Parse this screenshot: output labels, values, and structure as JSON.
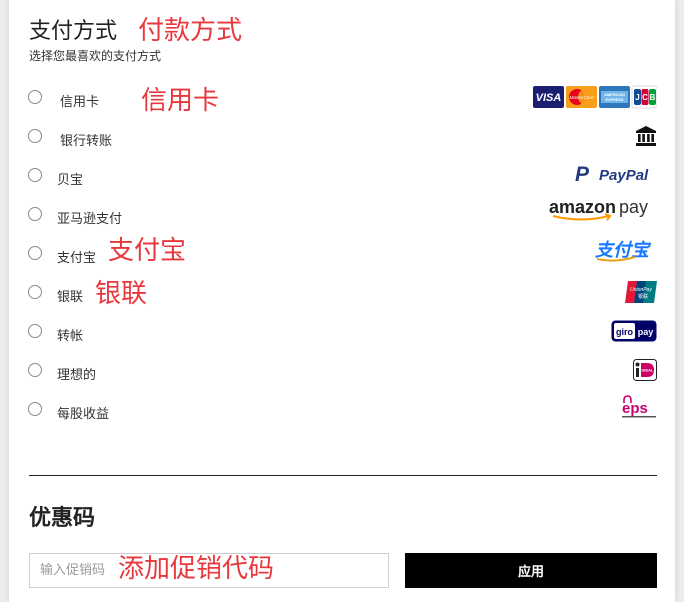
{
  "payment": {
    "title": "支付方式",
    "title_annotation": "付款方式",
    "subtitle": "选择您最喜欢的支付方式",
    "methods": [
      {
        "label": "信用卡",
        "annotation": "信用卡",
        "logo": "visa-mastercard-amex-jcb-logos",
        "logo_text": [
          "VISA",
          "MasterCard",
          "AMERICAN EXPRESS",
          "JCB"
        ]
      },
      {
        "label": "银行转账",
        "logo": "bank-icon"
      },
      {
        "label": "贝宝",
        "logo": "paypal-logo",
        "logo_text": [
          "PayPal"
        ]
      },
      {
        "label": "亚马逊支付",
        "logo": "amazon-pay-logo",
        "logo_text": [
          "amazon",
          "pay"
        ]
      },
      {
        "label": "支付宝",
        "annotation": "支付宝",
        "logo": "alipay-logo",
        "logo_text": [
          "支付宝"
        ]
      },
      {
        "label": "银联",
        "annotation": "银联",
        "logo": "unionpay-logo",
        "logo_text": [
          "UnionPay",
          "银联"
        ]
      },
      {
        "label": "转帐",
        "logo": "giropay-logo",
        "logo_text": [
          "giro",
          "pay"
        ]
      },
      {
        "label": "理想的",
        "logo": "ideal-logo",
        "logo_text": [
          "iDEAL"
        ]
      },
      {
        "label": "每股收益",
        "logo": "eps-logo",
        "logo_text": [
          "eps"
        ]
      }
    ]
  },
  "coupon": {
    "title": "优惠码",
    "input_placeholder": "输入促销码",
    "input_annotation": "添加促销代码",
    "apply_label": "应用"
  },
  "colors": {
    "annotation": "#e8383d",
    "button_bg": "#000000",
    "paypal_dark": "#253b80",
    "paypal_light": "#179bd7",
    "amazon_orange": "#ff9900",
    "alipay_blue": "#1677ff",
    "giropay_blue": "#000268",
    "eps_magenta": "#c8036f"
  }
}
